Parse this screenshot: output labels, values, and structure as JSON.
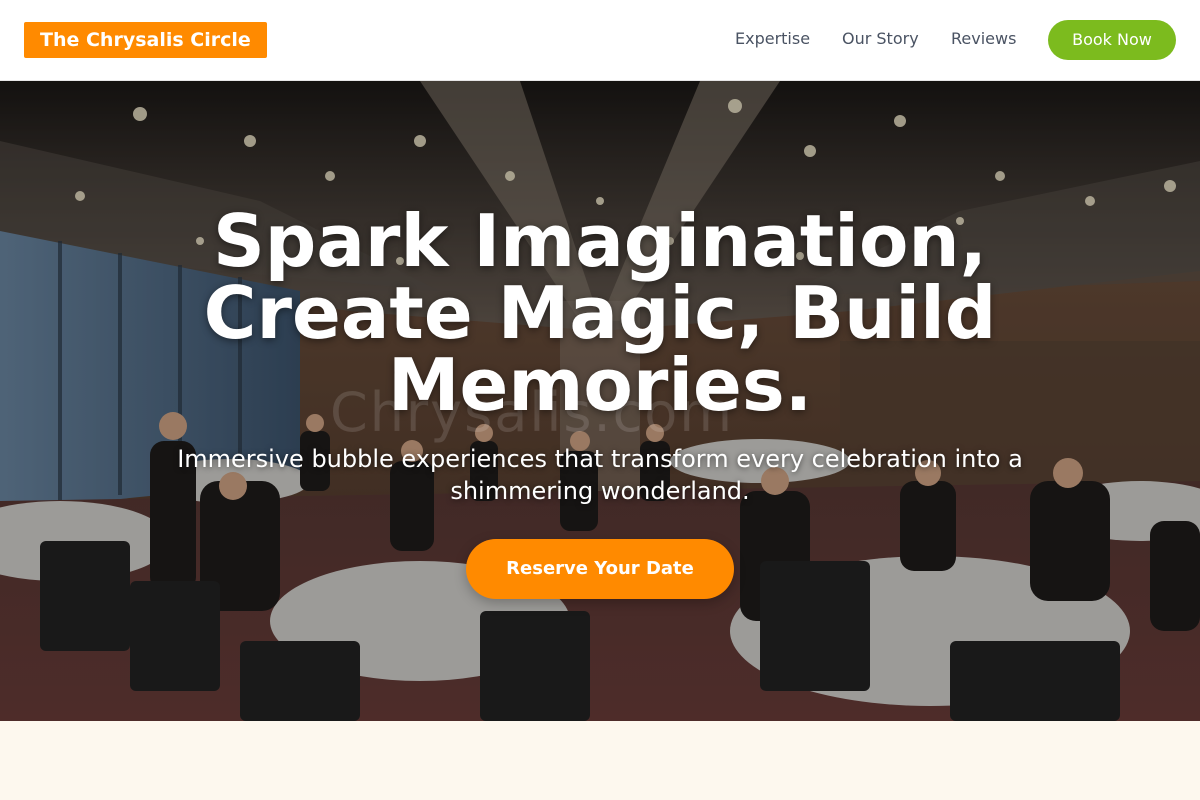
{
  "header": {
    "logo_text": "The Chrysalis Circle",
    "nav": [
      {
        "label": "Expertise"
      },
      {
        "label": "Our Story"
      },
      {
        "label": "Reviews"
      }
    ],
    "cta_label": "Book Now"
  },
  "hero": {
    "title": "Spark Imagination, Create Magic, Build Memories.",
    "subtitle": "Immersive bubble experiences that transform every celebration into a shimmering wonderland.",
    "cta_label": "Reserve Your Date",
    "watermark": "Chrysalis.com"
  },
  "colors": {
    "brand_orange": "#ff8a00",
    "accent_green": "#7cbb1e",
    "nav_text": "#4a5363",
    "page_background": "#fdf8ee"
  },
  "icons": []
}
